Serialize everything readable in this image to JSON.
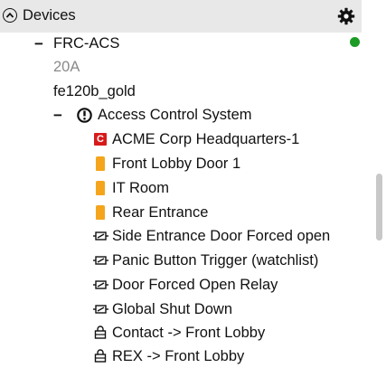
{
  "panel": {
    "title": "Devices",
    "icons": {
      "collapse": "chevron-up-circle-icon",
      "settings": "gear-icon"
    }
  },
  "tree": {
    "unit": {
      "label": "FRC-ACS",
      "status_color": "#1c9b25",
      "children": [
        {
          "label": "20A"
        },
        {
          "label": "fe120b_gold"
        }
      ]
    },
    "system": {
      "label": "Access Control System",
      "icon": "power-circle-icon",
      "items": [
        {
          "label": "ACME Corp Headquarters-1",
          "icon": "c-badge-icon"
        },
        {
          "label": "Front Lobby Door 1",
          "icon": "door-icon"
        },
        {
          "label": "IT Room",
          "icon": "door-icon"
        },
        {
          "label": "Rear Entrance",
          "icon": "door-icon"
        },
        {
          "label": "Side Entrance Door Forced open",
          "icon": "relay-icon"
        },
        {
          "label": "Panic Button Trigger (watchlist)",
          "icon": "relay-icon"
        },
        {
          "label": "Door Forced Open Relay",
          "icon": "relay-icon"
        },
        {
          "label": "Global Shut Down",
          "icon": "relay-icon"
        },
        {
          "label": "Contact -> Front Lobby",
          "icon": "lock-icon"
        },
        {
          "label": "REX -> Front Lobby",
          "icon": "lock-icon"
        }
      ]
    }
  },
  "colors": {
    "header_bg": "#e8e8e8",
    "door": "#f4a51c",
    "badge": "#d71b1b",
    "status_online": "#1c9b25"
  }
}
